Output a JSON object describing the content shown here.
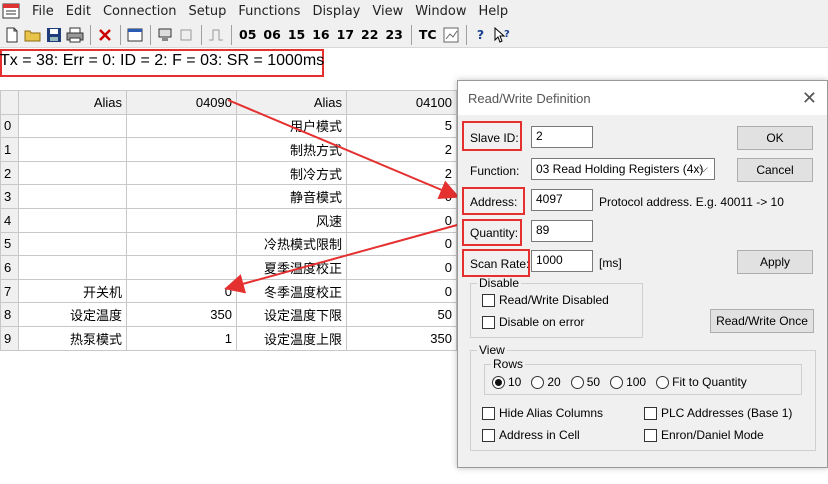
{
  "menubar": {
    "items": [
      "File",
      "Edit",
      "Connection",
      "Setup",
      "Functions",
      "Display",
      "View",
      "Window",
      "Help"
    ]
  },
  "toolbar": {
    "codes": [
      "05",
      "06",
      "15",
      "16",
      "17",
      "22",
      "23"
    ],
    "tc_label": "TC",
    "help_label": "?"
  },
  "status": {
    "text": "Tx = 38: Err = 0: ID = 2: F = 03: SR = 1000ms"
  },
  "grid": {
    "headers": [
      "Alias",
      "04090",
      "Alias",
      "04100"
    ],
    "rows": [
      {
        "idx": "0",
        "a1": "",
        "v1": "",
        "a2": "用户模式",
        "v2": "5"
      },
      {
        "idx": "1",
        "a1": "",
        "v1": "",
        "a2": "制热方式",
        "v2": "2"
      },
      {
        "idx": "2",
        "a1": "",
        "v1": "",
        "a2": "制冷方式",
        "v2": "2"
      },
      {
        "idx": "3",
        "a1": "",
        "v1": "",
        "a2": "静音模式",
        "v2": "0"
      },
      {
        "idx": "4",
        "a1": "",
        "v1": "",
        "a2": "风速",
        "v2": "0"
      },
      {
        "idx": "5",
        "a1": "",
        "v1": "",
        "a2": "冷热模式限制",
        "v2": "0"
      },
      {
        "idx": "6",
        "a1": "",
        "v1": "",
        "a2": "夏季温度校正",
        "v2": "0"
      },
      {
        "idx": "7",
        "a1": "开关机",
        "v1": "0",
        "a2": "冬季温度校正",
        "v2": "0"
      },
      {
        "idx": "8",
        "a1": "设定温度",
        "v1": "350",
        "a2": "设定温度下限",
        "v2": "50"
      },
      {
        "idx": "9",
        "a1": "热泵模式",
        "v1": "1",
        "a2": "设定温度上限",
        "v2": "350"
      }
    ]
  },
  "dialog": {
    "title": "Read/Write Definition",
    "slave_id_label": "Slave ID:",
    "slave_id_value": "2",
    "function_label": "Function:",
    "function_value": "03 Read Holding Registers (4x)",
    "address_label": "Address:",
    "address_value": "4097",
    "address_hint": "Protocol address. E.g. 40011 -> 10",
    "quantity_label": "Quantity:",
    "quantity_value": "89",
    "scan_rate_label": "Scan Rate:",
    "scan_rate_value": "1000",
    "scan_rate_unit": "[ms]",
    "ok_label": "OK",
    "cancel_label": "Cancel",
    "apply_label": "Apply",
    "disable": {
      "legend": "Disable",
      "rw_disabled": "Read/Write Disabled",
      "disable_on_error": "Disable on error"
    },
    "read_write_once_label": "Read/Write Once",
    "view": {
      "legend": "View",
      "rows_legend": "Rows",
      "rows_options": [
        "10",
        "20",
        "50",
        "100",
        "Fit to Quantity"
      ],
      "rows_selected": "10",
      "hide_alias": "Hide Alias Columns",
      "address_in_cell": "Address in Cell",
      "plc_addresses": "PLC Addresses (Base 1)",
      "enron_daniel": "Enron/Daniel Mode"
    }
  },
  "colors": {
    "highlight_red": "#e53030",
    "window_bg": "#f0f0f0"
  }
}
